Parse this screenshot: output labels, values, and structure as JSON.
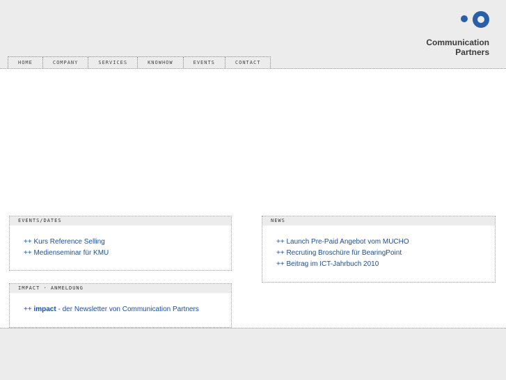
{
  "logo": {
    "line1": "Communication",
    "line2": "Partners"
  },
  "nav": [
    "HOME",
    "COMPANY",
    "SERVICES",
    "KNOWHOW",
    "EVENTS",
    "CONTACT"
  ],
  "events": {
    "title": "EVENTS/DATES",
    "items": [
      "++ Kurs Reference Selling",
      "++ Medienseminar für KMU"
    ]
  },
  "news": {
    "title": "NEWS",
    "items": [
      "++ Launch Pre-Paid Angebot vom MUCHO",
      "++ Recruting Broschüre für BearingPoint",
      "++ Beitrag im ICT-Jahrbuch 2010"
    ]
  },
  "impact": {
    "title": "IMPACT · ANMELDUNG",
    "prefix": "++ ",
    "bold": "impact",
    "suffix": " - der Newsletter von Communication Partners"
  },
  "colors": {
    "accent": "#2a5ea8",
    "link": "#1a4fa0",
    "bg_grey": "#ececec"
  }
}
